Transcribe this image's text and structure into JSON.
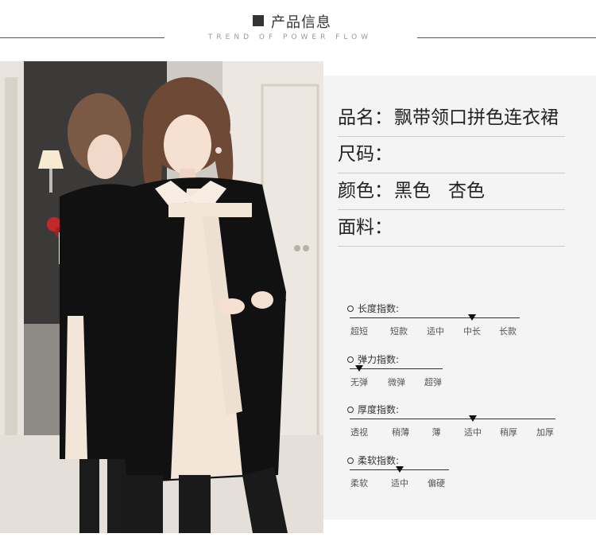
{
  "header": {
    "title": "产品信息",
    "subtitle": "TREND OF POWER FLOW"
  },
  "info": {
    "name_label": "品名：",
    "name_value": "飘带领口拼色连衣裙",
    "size_label": "尺码：",
    "color_label": "颜色：",
    "color_1": "黑色",
    "color_2": "杏色",
    "fabric_label": "面料："
  },
  "scales": [
    {
      "title": "长度指数:",
      "options": [
        "超短",
        "短款",
        "适中",
        "中长",
        "长款"
      ],
      "selected_index": 3
    },
    {
      "title": "弹力指数:",
      "options": [
        "无弹",
        "微弹",
        "超弹"
      ],
      "selected_index": 0
    },
    {
      "title": "厚度指数:",
      "options": [
        "透视",
        "稍薄",
        "薄",
        "适中",
        "稍厚",
        "加厚"
      ],
      "selected_index": 3
    },
    {
      "title": "柔软指数:",
      "options": [
        "柔软",
        "适中",
        "偏硬"
      ],
      "selected_index": 1
    }
  ],
  "colors": {
    "dress_black": "#111111",
    "dress_cream": "#f3e6d8",
    "panel_bg": "#f4f4f4"
  }
}
